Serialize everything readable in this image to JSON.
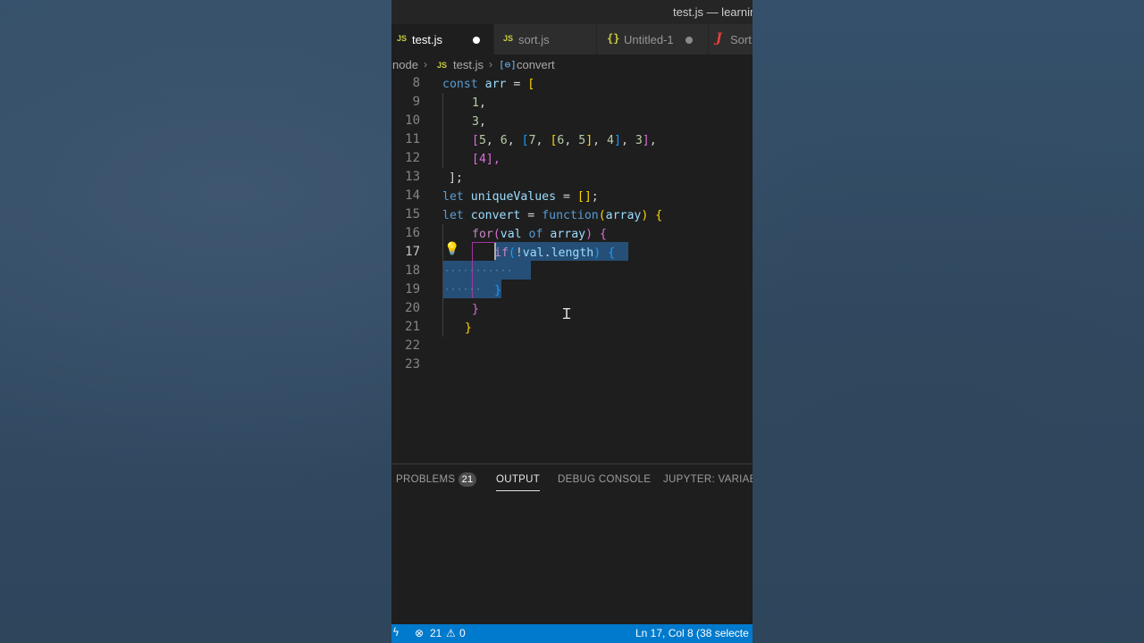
{
  "window": {
    "title": "test.js — learnin"
  },
  "tabs": [
    {
      "icon": "JS",
      "label": "test.js",
      "modified": true
    },
    {
      "icon": "JS",
      "label": "sort.js"
    },
    {
      "icon": "{}",
      "label": "Untitled-1",
      "modified": true
    },
    {
      "icon": "J",
      "label": "Sort"
    }
  ],
  "breadcrumb": {
    "folder": "node",
    "file_icon": "JS",
    "file": "test.js",
    "symbol_icon": "[⊖]",
    "symbol": "convert"
  },
  "editor": {
    "line_numbers": [
      "8",
      "9",
      "10",
      "11",
      "12",
      "13",
      "14",
      "15",
      "16",
      "17",
      "18",
      "19",
      "20",
      "21",
      "22",
      "23"
    ],
    "current_line": "17",
    "code": {
      "l8": {
        "kw": "const",
        "name": " arr",
        "rest": " = ",
        "open": "["
      },
      "l9": {
        "val": "1",
        "comma": ","
      },
      "l10": {
        "val": "3",
        "comma": ","
      },
      "l11": {
        "text": "[5, 6, [7, [6, 5], 4], 3],"
      },
      "l12": {
        "text": "[4],"
      },
      "l13": {
        "text": "];"
      },
      "l14": {
        "kw": "let",
        "name": " uniqueValues",
        "rest": " = ",
        "val": "[]",
        "end": ";"
      },
      "l15": {
        "kw": "let",
        "name": " convert",
        "rest": " = ",
        "fn": "function",
        "paren": "(",
        "param": "array",
        "close": ")",
        "brace": " {"
      },
      "l16": {
        "kw": "for",
        "paren": "(",
        "v1": "val",
        "of": " of ",
        "v2": "array",
        "close": ")",
        "brace": " {"
      },
      "l17": {
        "kw": "if",
        "paren": "(",
        "neg": "!",
        "obj": "val",
        "dot": ".",
        "prop": "length",
        "close": ")",
        "brace": " {"
      },
      "l19": {
        "brace": "}"
      },
      "l20": {
        "brace": "}"
      },
      "l21": {
        "brace": "}"
      }
    }
  },
  "panel": {
    "tabs": [
      "PROBLEMS",
      "OUTPUT",
      "DEBUG CONSOLE",
      "JUPYTER: VARIABL"
    ],
    "problems_count": "21",
    "active_tab": "OUTPUT"
  },
  "statusbar": {
    "remote_icon": "ϟ",
    "errors": "21",
    "warnings": "0",
    "position": "Ln 17, Col 8 (38 selecte"
  },
  "colors": {
    "accent": "#007acc",
    "editor_bg": "#1e1e1e",
    "selection": "#264f78"
  }
}
